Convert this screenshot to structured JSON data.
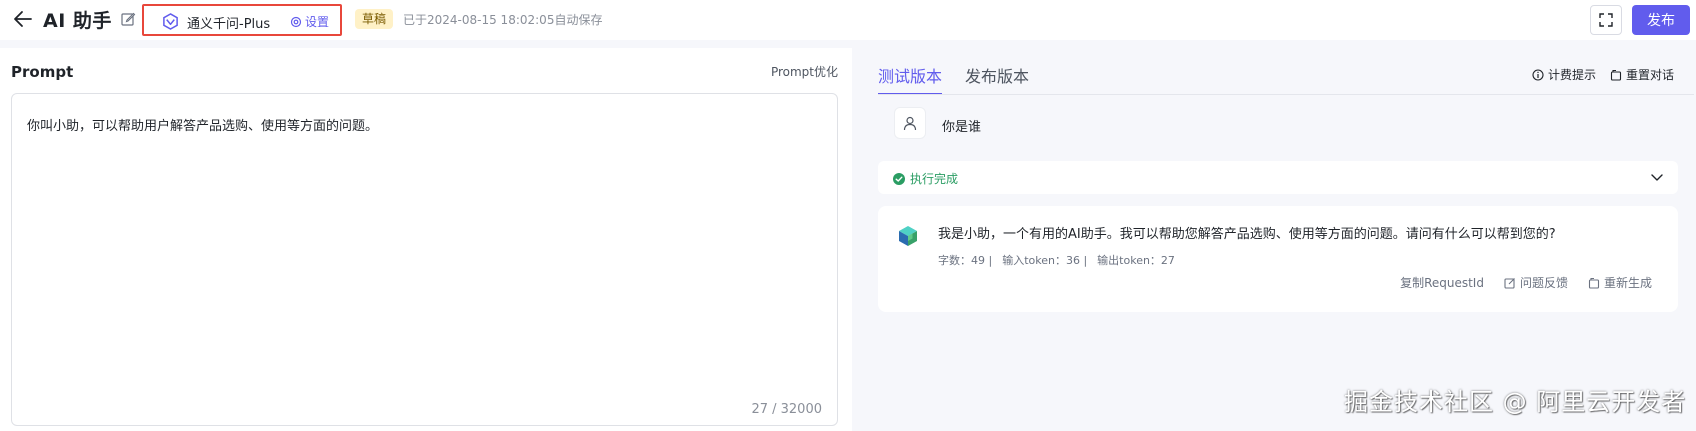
{
  "header": {
    "back_icon": "arrow-left-icon",
    "title": "AI 助手",
    "edit_icon": "pencil-square-icon",
    "model": {
      "icon": "tongyi-logo-icon",
      "name": "通义千问-Plus",
      "settings_icon": "gear-icon",
      "settings_label": "设置"
    },
    "draft_badge": "草稿",
    "save_status": "已于2024-08-15 18:02:05自动保存",
    "fullscreen_icon": "fullscreen-icon",
    "publish_label": "发布"
  },
  "prompt": {
    "label": "Prompt",
    "optimize_label": "Prompt优化",
    "text": "你叫小助，可以帮助用户解答产品选购、使用等方面的问题。",
    "counter": "27 / 32000"
  },
  "right": {
    "tabs": [
      {
        "label": "测试版本",
        "active": true
      },
      {
        "label": "发布版本",
        "active": false
      }
    ],
    "actions": [
      {
        "icon": "info-circle-icon",
        "label": "计费提示"
      },
      {
        "icon": "reset-chat-icon",
        "label": "重置对话"
      }
    ],
    "user_message": {
      "avatar_icon": "user-icon",
      "text": "你是谁"
    },
    "exec": {
      "icon": "check-circle-icon",
      "label": "执行完成",
      "chevron_icon": "chevron-down-icon"
    },
    "answer": {
      "avatar_icon": "bot-cube-icon",
      "text": "我是小助，一个有用的AI助手。我可以帮助您解答产品选购、使用等方面的问题。请问有什么可以帮到您的?",
      "stats": {
        "chars": "字数：49 |",
        "input_tokens": "输入token：36 |",
        "output_tokens": "输出token：27"
      },
      "actions": [
        {
          "icon": "",
          "label": "复制RequestId"
        },
        {
          "icon": "feedback-edit-icon",
          "label": "问题反馈"
        },
        {
          "icon": "regenerate-icon",
          "label": "重新生成"
        }
      ]
    }
  },
  "watermark": "掘金技术社区 @ 阿里云开发者",
  "colors": {
    "accent": "#615ced",
    "highlight_border": "#e8473b",
    "success": "#2a9d63",
    "draft_bg": "#fff1c7"
  }
}
